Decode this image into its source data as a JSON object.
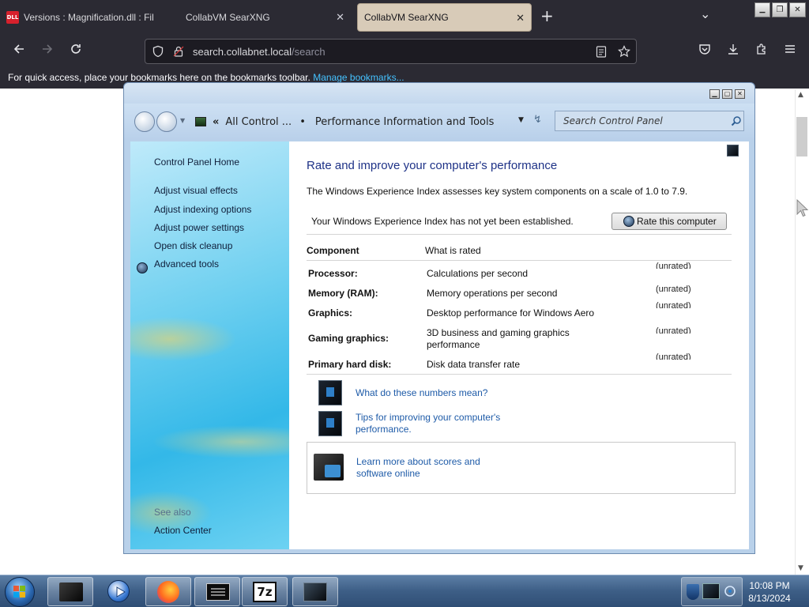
{
  "browser": {
    "tabs": [
      {
        "icon_text": "DLL",
        "title": "Versions : Magnification.dll : Fil",
        "close_glyph": "✕"
      },
      {
        "title": "CollabVM SearXNG",
        "close_glyph": "✕"
      },
      {
        "title": "CollabVM SearXNG",
        "close_glyph": "✕",
        "active": true
      }
    ],
    "new_tab_glyph": "+",
    "tab_list_glyph": "⌄",
    "window_controls": [
      "▁",
      "❐",
      "✕"
    ],
    "url": {
      "host": "search.collabnet.local",
      "path": "/search"
    },
    "nav_icons": [
      "back-arrow-icon",
      "forward-arrow-icon",
      "reload-icon",
      "shield-icon",
      "lock-icon",
      "reader-icon",
      "star-icon",
      "pocket-icon",
      "download-icon",
      "extensions-icon",
      "menu-icon"
    ],
    "bookmarks_message": "For quick access, place your bookmarks here on the bookmarks toolbar.",
    "bookmarks_link": "Manage bookmarks..."
  },
  "control_panel": {
    "breadcrumb": {
      "chevron": "«",
      "parent": "All Control ...",
      "separator": "•",
      "current": "Performance Information and Tools"
    },
    "search_placeholder": "Search Control Panel",
    "sidebar": {
      "home": "Control Panel Home",
      "links": [
        "Adjust visual effects",
        "Adjust indexing options",
        "Adjust power settings",
        "Open disk cleanup",
        "Advanced tools"
      ],
      "see_also_label": "See also",
      "see_also_links": [
        "Action Center"
      ]
    },
    "main": {
      "heading": "Rate and improve your computer's performance",
      "subtitle": "The Windows Experience Index assesses key system components on a scale of 1.0 to 7.9.",
      "status_message": "Your Windows Experience Index has not yet been established.",
      "rate_button": "Rate this computer",
      "columns": {
        "component": "Component",
        "what_rated": "What is rated"
      },
      "rows": [
        {
          "component": "Processor:",
          "rated": "Calculations per second",
          "score": "(unrated)"
        },
        {
          "component": "Memory (RAM):",
          "rated": "Memory operations per second",
          "score": "(unrated)"
        },
        {
          "component": "Graphics:",
          "rated": "Desktop performance for Windows Aero",
          "score": "(unrated)"
        },
        {
          "component": "Gaming graphics:",
          "rated": "3D business and gaming graphics performance",
          "score": "(unrated)"
        },
        {
          "component": "Primary hard disk:",
          "rated": "Disk data transfer rate",
          "score": "(unrated)"
        }
      ],
      "help_links": [
        "What do these numbers mean?",
        "Tips for improving your computer's performance."
      ],
      "learn_more": "Learn more about scores and software online"
    }
  },
  "taskbar": {
    "time": "10:08 PM",
    "date": "8/13/2024",
    "pinned_icons": [
      "control-panel-icon",
      "media-player-icon",
      "firefox-icon",
      "console-icon",
      "7zip-icon",
      "monitor-icon"
    ],
    "seven_zip_label": "7z"
  }
}
